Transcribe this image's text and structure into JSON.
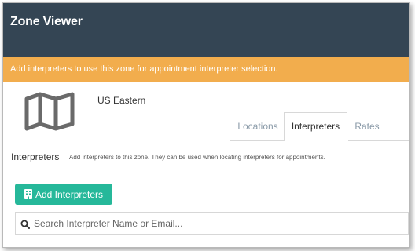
{
  "header": {
    "title": "Zone Viewer"
  },
  "notice": {
    "text": "Add interpreters to use this zone for appointment interpreter selection."
  },
  "zone": {
    "name": "US Eastern",
    "icon": "map-icon"
  },
  "tabs": [
    {
      "label": "Locations",
      "active": false
    },
    {
      "label": "Interpreters",
      "active": true
    },
    {
      "label": "Rates",
      "active": false
    }
  ],
  "section": {
    "title": "Interpreters",
    "description": "Add interpreters to this zone. They can be used when locating interpreters for appointments."
  },
  "add_button": {
    "label": "Add Interpreters",
    "icon": "building-icon"
  },
  "search": {
    "placeholder": "Search Interpreter Name or Email...",
    "value": "",
    "icon": "search-icon"
  },
  "colors": {
    "header_bg": "#344554",
    "notice_bg": "#f2ad4d",
    "button_bg": "#26b89a"
  }
}
